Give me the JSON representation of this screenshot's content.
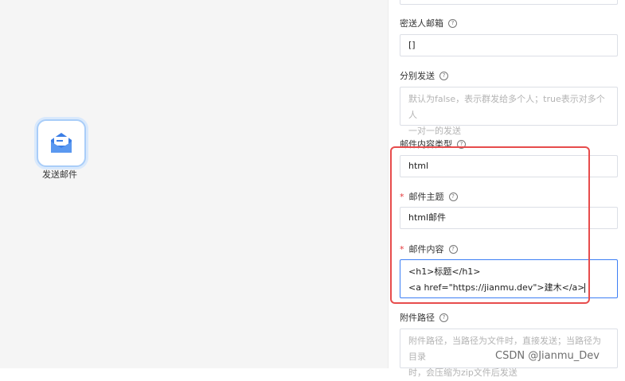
{
  "canvas": {
    "node_label": "发送邮件"
  },
  "form": {
    "sender_label": "密送人邮箱",
    "sender_value": "[]",
    "separate_label": "分别发送",
    "separate_placeholder_line1": "默认为false，表示群发给多个人；true表示对多个人",
    "separate_placeholder_line2": "一对一的发送",
    "content_type_label": "邮件内容类型",
    "content_type_value": "html",
    "subject_label": "邮件主题",
    "subject_value": "html邮件",
    "content_label": "邮件内容",
    "content_line1": "<h1>标题</h1>",
    "content_line2": "<a href=\"https://jianmu.dev\">建木</a>",
    "attachment_label": "附件路径",
    "attachment_placeholder_line1": "附件路径，当路径为文件时，直接发送；当路径为目录",
    "attachment_placeholder_line2": "时，会压缩为zip文件后发送",
    "required_mark": "*",
    "help_mark": "?"
  },
  "watermark": "CSDN @Jianmu_Dev",
  "colors": {
    "accent": "#3d7ff5",
    "highlight": "#e74c4c",
    "required": "#e5383b"
  }
}
